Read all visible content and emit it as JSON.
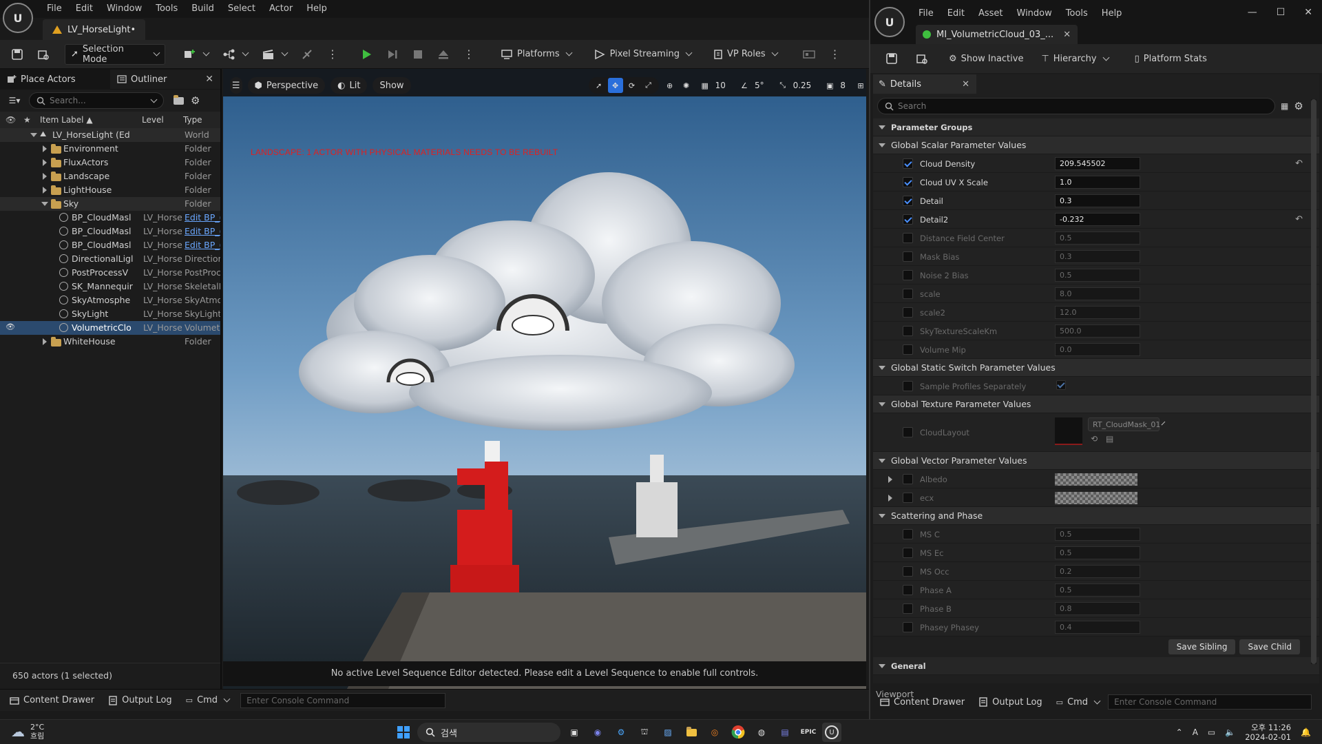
{
  "editor": {
    "menu": [
      "File",
      "Edit",
      "Window",
      "Tools",
      "Build",
      "Select",
      "Actor",
      "Help"
    ],
    "level_tab": "LV_HorseLight•",
    "toolbar": {
      "mode": "Selection Mode",
      "platforms": "Platforms",
      "pixel_streaming": "Pixel Streaming",
      "vp_roles": "VP Roles"
    }
  },
  "outliner": {
    "tab_place_actors": "Place Actors",
    "tab_outliner": "Outliner",
    "search_placeholder": "Search...",
    "columns": {
      "label": "Item Label",
      "level": "Level",
      "type": "Type"
    },
    "rows": [
      {
        "label": "LV_HorseLight (Ed",
        "level": "",
        "type": "World"
      },
      {
        "label": "Environment",
        "level": "",
        "type": "Folder"
      },
      {
        "label": "FluxActors",
        "level": "",
        "type": "Folder"
      },
      {
        "label": "Landscape",
        "level": "",
        "type": "Folder"
      },
      {
        "label": "LightHouse",
        "level": "",
        "type": "Folder"
      },
      {
        "label": "Sky",
        "level": "",
        "type": "Folder"
      },
      {
        "label": "BP_CloudMasl",
        "level": "LV_Horse",
        "type": "Edit BP_("
      },
      {
        "label": "BP_CloudMasl",
        "level": "LV_Horse",
        "type": "Edit BP_("
      },
      {
        "label": "BP_CloudMasl",
        "level": "LV_Horse",
        "type": "Edit BP_("
      },
      {
        "label": "DirectionalLigl",
        "level": "LV_Horse",
        "type": "Direction"
      },
      {
        "label": "PostProcessV",
        "level": "LV_Horse",
        "type": "PostProc"
      },
      {
        "label": "SK_Mannequir",
        "level": "LV_Horse",
        "type": "SkeletalN"
      },
      {
        "label": "SkyAtmosphe",
        "level": "LV_Horse",
        "type": "SkyAtmo"
      },
      {
        "label": "SkyLight",
        "level": "LV_Horse",
        "type": "SkyLight"
      },
      {
        "label": "VolumetricClo",
        "level": "LV_Horse",
        "type": "Volumetr"
      },
      {
        "label": "WhiteHouse",
        "level": "",
        "type": "Folder"
      }
    ],
    "status": "650 actors (1 selected)"
  },
  "viewport": {
    "perspective": "Perspective",
    "lit": "Lit",
    "show": "Show",
    "grid": "10",
    "angle": "5°",
    "scale": "0.25",
    "camera": "8",
    "warning": "LANDSCAPE: 1 ACTOR WITH PHYSICAL MATERIALS NEEDS TO BE REBUILT",
    "status": "No active Level Sequence Editor detected. Please edit a Level Sequence to enable full controls."
  },
  "bottom": {
    "content_drawer": "Content Drawer",
    "output_log": "Output Log",
    "cmd": "Cmd",
    "console_placeholder": "Enter Console Command"
  },
  "mi": {
    "menu": [
      "File",
      "Edit",
      "Asset",
      "Window",
      "Tools",
      "Help"
    ],
    "tab": "MI_VolumetricCloud_03_...",
    "toolbar": {
      "show_inactive": "Show Inactive",
      "hierarchy": "Hierarchy",
      "platform_stats": "Platform Stats"
    },
    "details_tab": "Details",
    "search_placeholder": "Search",
    "parameter_groups": "Parameter Groups",
    "scalar_group": "Global Scalar Parameter Values",
    "scalar_params": [
      {
        "name": "Cloud Density",
        "value": "209.545502",
        "on": true,
        "reset": true
      },
      {
        "name": "Cloud UV X Scale",
        "value": "1.0",
        "on": true,
        "reset": false
      },
      {
        "name": "Detail",
        "value": "0.3",
        "on": true,
        "reset": false
      },
      {
        "name": "Detail2",
        "value": "-0.232",
        "on": true,
        "reset": true
      },
      {
        "name": "Distance Field Center",
        "value": "0.5",
        "on": false,
        "reset": false
      },
      {
        "name": "Mask Bias",
        "value": "0.3",
        "on": false,
        "reset": false
      },
      {
        "name": "Noise 2 Bias",
        "value": "0.5",
        "on": false,
        "reset": false
      },
      {
        "name": "scale",
        "value": "8.0",
        "on": false,
        "reset": false
      },
      {
        "name": "scale2",
        "value": "12.0",
        "on": false,
        "reset": false
      },
      {
        "name": "SkyTextureScaleKm",
        "value": "500.0",
        "on": false,
        "reset": false
      },
      {
        "name": "Volume Mip",
        "value": "0.0",
        "on": false,
        "reset": false
      }
    ],
    "switch_group": "Global Static Switch Parameter Values",
    "switch_param": "Sample Profiles Separately",
    "texture_group": "Global Texture Parameter Values",
    "texture_param": "CloudLayout",
    "texture_value": "RT_CloudMask_01",
    "vector_group": "Global Vector Parameter Values",
    "vector_params": [
      "Albedo",
      "ecx"
    ],
    "scatter_group": "Scattering and Phase",
    "scatter_params": [
      {
        "name": "MS C",
        "value": "0.5"
      },
      {
        "name": "MS Ec",
        "value": "0.5"
      },
      {
        "name": "MS Occ",
        "value": "0.2"
      },
      {
        "name": "Phase A",
        "value": "0.5"
      },
      {
        "name": "Phase B",
        "value": "0.8"
      },
      {
        "name": "Phasey Phasey",
        "value": "0.4"
      }
    ],
    "save_sibling": "Save Sibling",
    "save_child": "Save Child",
    "general_group": "General",
    "viewport_tab": "Viewport",
    "bottom": {
      "content_drawer": "Content Drawer",
      "output_log": "Output Log",
      "cmd": "Cmd",
      "console_placeholder": "Enter Console Command"
    }
  },
  "taskbar": {
    "weather_temp": "2°C",
    "weather_desc": "흐림",
    "search": "검색",
    "time": "오후 11:26",
    "date": "2024-02-01",
    "ime": "A"
  },
  "colors": {
    "accent": "#2b4a6e",
    "warning": "#e02020",
    "checkbox": "#4a90ff",
    "play": "#3fbf3f",
    "folder": "#c8a050"
  }
}
